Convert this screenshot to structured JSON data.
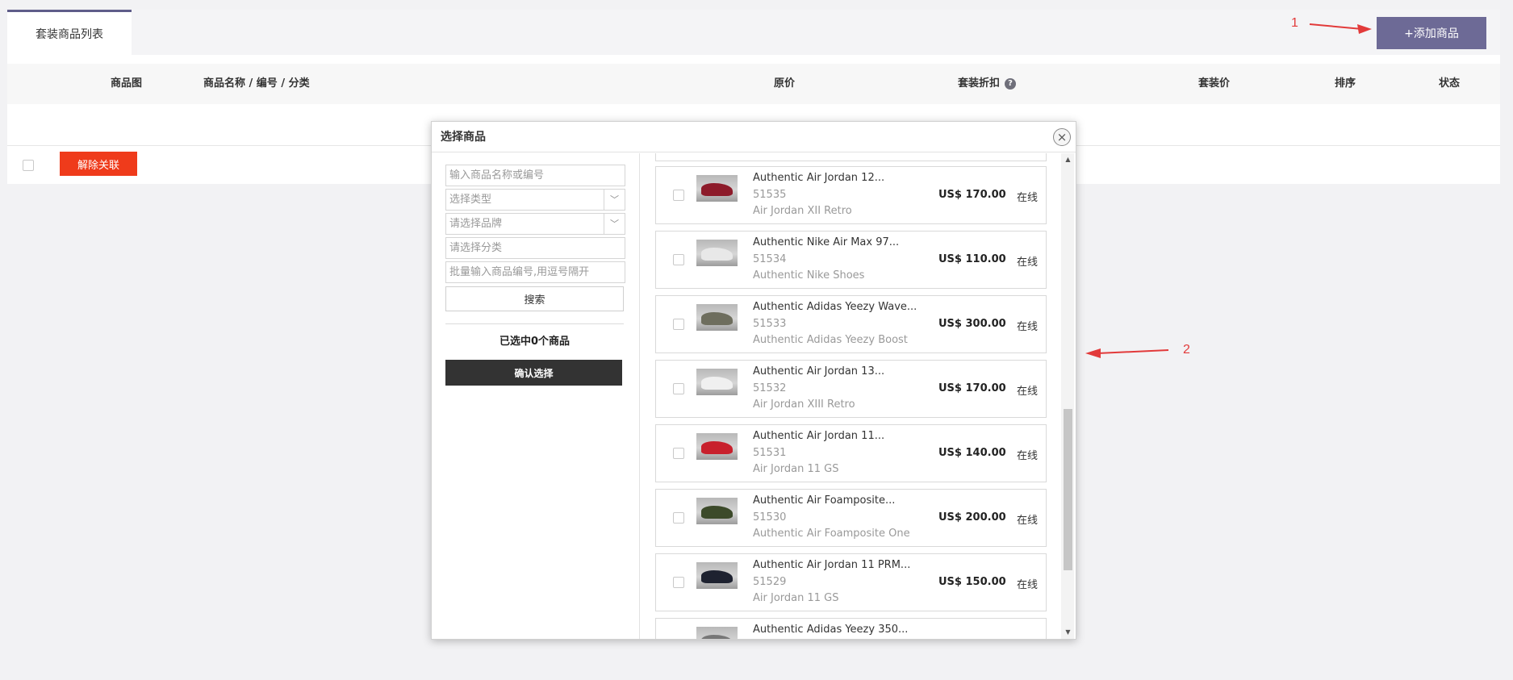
{
  "tabs": {
    "active_label": "套装商品列表"
  },
  "toolbar": {
    "add_label": "+添加商品"
  },
  "table": {
    "headers": {
      "image": "商品图",
      "name": "商品名称 / 编号 / 分类",
      "price": "原价",
      "discount": "套装折扣",
      "set_price": "套装价",
      "sort": "排序",
      "status": "状态"
    },
    "help_glyph": "?"
  },
  "footer": {
    "unlink_label": "解除关联"
  },
  "annotations": {
    "one": "1",
    "two": "2",
    "color": "#e23a3a"
  },
  "modal": {
    "title": "选择商品",
    "close_glyph": "×",
    "filters": {
      "name_placeholder": "输入商品名称或编号",
      "type_placeholder": "选择类型",
      "brand_placeholder": "请选择品牌",
      "category_placeholder": "请选择分类",
      "batch_placeholder": "批量输入商品编号,用逗号隔开",
      "search_label": "搜索"
    },
    "selected_count_text": "已选中0个商品",
    "confirm_label": "确认选择",
    "products": [
      {
        "name": "Authentic Air Jordan 12...",
        "code": "51535",
        "category": "Air Jordan XII Retro",
        "price": "US$ 170.00",
        "status": "在线",
        "thumb_color": "#8d1b2a"
      },
      {
        "name": "Authentic Nike Air Max 97...",
        "code": "51534",
        "category": "Authentic Nike Shoes",
        "price": "US$ 110.00",
        "status": "在线",
        "thumb_color": "#e8e8e8"
      },
      {
        "name": "Authentic Adidas Yeezy Wave...",
        "code": "51533",
        "category": "Authentic Adidas Yeezy Boost",
        "price": "US$ 300.00",
        "status": "在线",
        "thumb_color": "#6e6e5e"
      },
      {
        "name": "Authentic Air Jordan 13...",
        "code": "51532",
        "category": "Air Jordan XIII Retro",
        "price": "US$ 170.00",
        "status": "在线",
        "thumb_color": "#f0f0f0"
      },
      {
        "name": "Authentic Air Jordan 11...",
        "code": "51531",
        "category": "Air Jordan 11 GS",
        "price": "US$ 140.00",
        "status": "在线",
        "thumb_color": "#c8202c"
      },
      {
        "name": "Authentic Air Foamposite...",
        "code": "51530",
        "category": "Authentic Air Foamposite One",
        "price": "US$ 200.00",
        "status": "在线",
        "thumb_color": "#3c4a2a"
      },
      {
        "name": "Authentic Air Jordan 11 PRM...",
        "code": "51529",
        "category": "Air Jordan 11 GS",
        "price": "US$ 150.00",
        "status": "在线",
        "thumb_color": "#1e2230"
      },
      {
        "name": "Authentic Adidas Yeezy 350...",
        "code": "",
        "category": "",
        "price": "",
        "status": "",
        "thumb_color": "#777777"
      }
    ]
  }
}
